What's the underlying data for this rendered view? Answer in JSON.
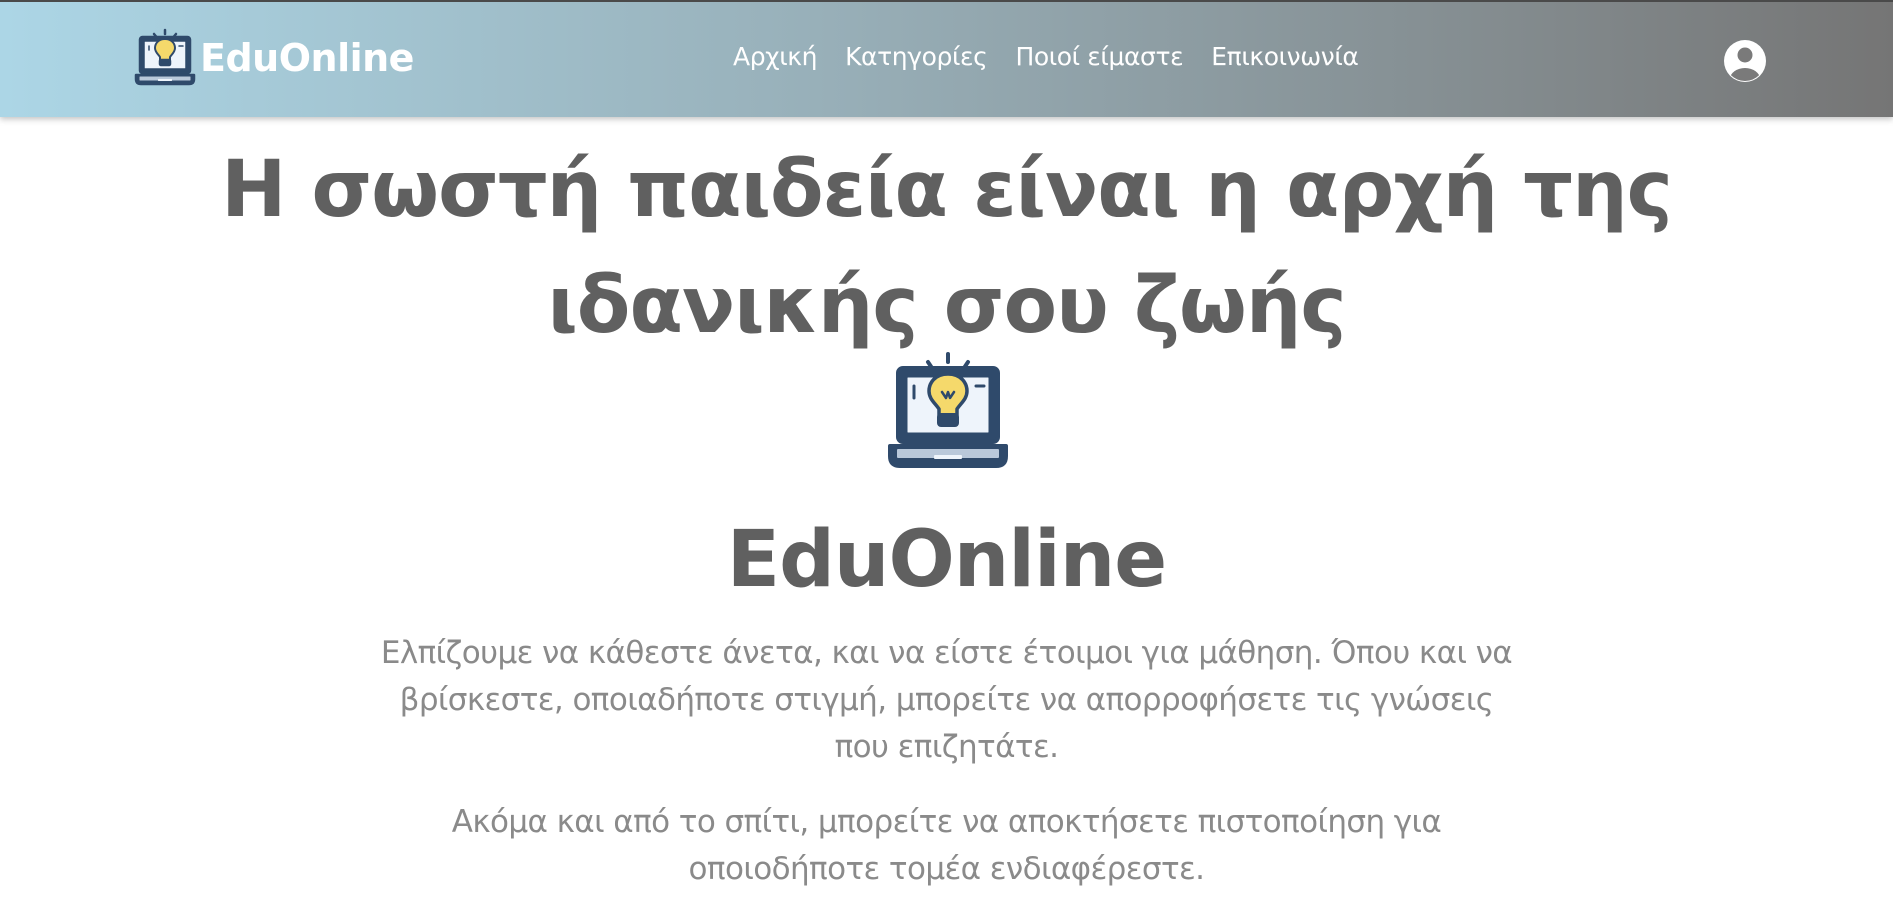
{
  "navbar": {
    "brand_name": "EduOnline",
    "brand_icon": "laptop-lightbulb-icon",
    "links": [
      {
        "label": "Αρχική"
      },
      {
        "label": "Κατηγορίες"
      },
      {
        "label": "Ποιοί είμαστε"
      },
      {
        "label": "Επικοινωνία"
      }
    ],
    "account_icon": "user-circle-icon"
  },
  "hero": {
    "title": "Η σωστή παιδεία είναι η αρχή της ιδανικής σου ζωής",
    "logo_icon": "laptop-lightbulb-icon",
    "brand_name": "EduOnline",
    "paragraphs": [
      "Ελπίζουμε να κάθεστε άνετα, και να είστε έτοιμοι για μάθηση. Όπου και να βρίσκεστε, οποιαδήποτε στιγμή, μπορείτε να απορροφήσετε τις γνώσεις που επιζητάτε.",
      "Ακόμα και από το σπίτι, μπορείτε να αποκτήσετε πιστοποίηση για οποιοδήποτε τομέα ενδιαφέρεστε."
    ]
  },
  "colors": {
    "nav_gradient_start": "#acd6e6",
    "nav_gradient_end": "#757575",
    "heading_text": "#606060",
    "body_text": "#8a8a8a",
    "laptop_outline": "#2f4a6b",
    "bulb_yellow": "#f5d96b"
  }
}
